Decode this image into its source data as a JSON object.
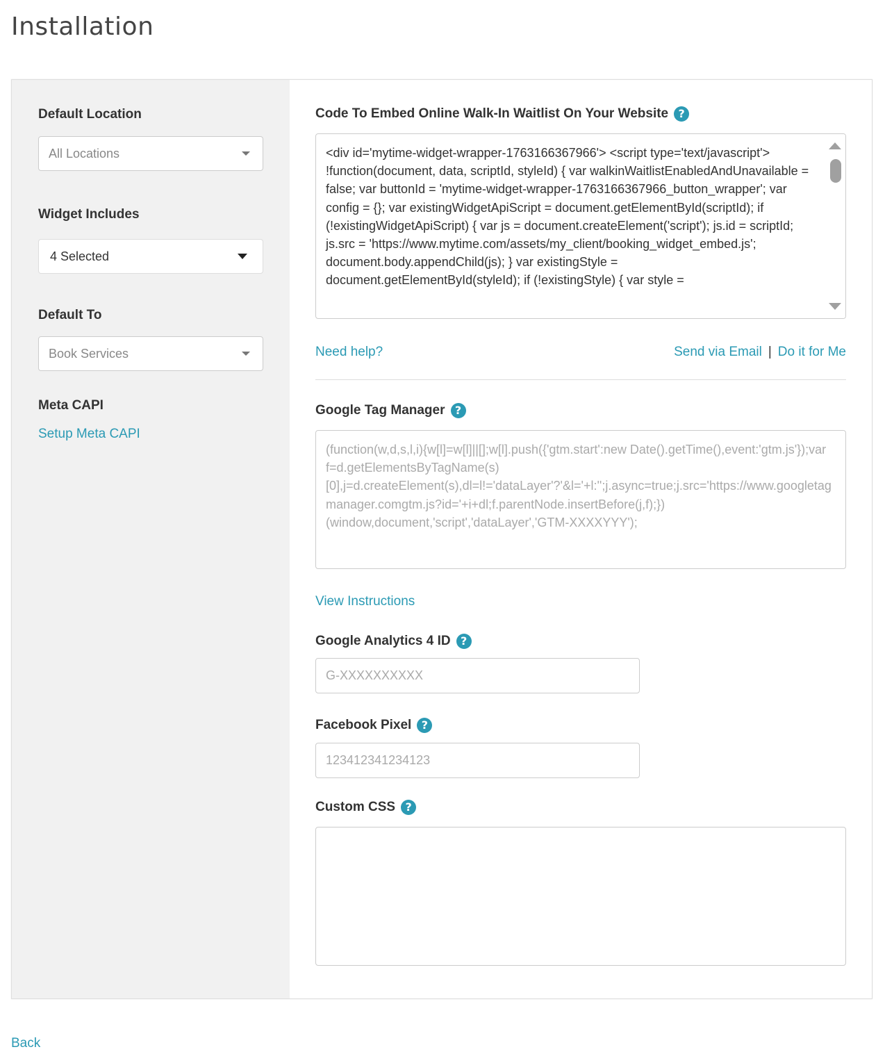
{
  "page": {
    "title": "Installation"
  },
  "sidebar": {
    "default_location": {
      "label": "Default Location",
      "value": "All Locations"
    },
    "widget_includes": {
      "label": "Widget Includes",
      "value": "4 Selected"
    },
    "default_to": {
      "label": "Default To",
      "value": "Book Services"
    },
    "meta_capi": {
      "label": "Meta CAPI",
      "link": "Setup Meta CAPI"
    }
  },
  "embed": {
    "label": "Code To Embed Online Walk-In Waitlist On Your Website",
    "help_icon": "?",
    "code": "<div id='mytime-widget-wrapper-1763166367966'> <script type='text/javascript'> !function(document, data, scriptId, styleId) { var walkinWaitlistEnabledAndUnavailable = false; var buttonId = 'mytime-widget-wrapper-1763166367966_button_wrapper';  var config = {}; var existingWidgetApiScript = document.getElementById(scriptId); if (!existingWidgetApiScript) { var js = document.createElement('script'); js.id = scriptId; js.src = 'https://www.mytime.com/assets/my_client/booking_widget_embed.js'; document.body.appendChild(js); } var existingStyle = document.getElementById(styleId); if (!existingStyle) { var style =",
    "need_help": "Need help?",
    "send_email": "Send via Email",
    "separator": "|",
    "do_it": "Do it for Me"
  },
  "gtm": {
    "label": "Google Tag Manager",
    "help_icon": "?",
    "placeholder": "(function(w,d,s,l,i){w[l]=w[l]||[];w[l].push({'gtm.start':new Date().getTime(),event:'gtm.js'});var f=d.getElementsByTagName(s)[0],j=d.createElement(s),dl=l!='dataLayer'?'&l='+l:'';j.async=true;j.src='https://www.googletagmanager.comgtm.js?id='+i+dl;f.parentNode.insertBefore(j,f);})(window,document,'script','dataLayer','GTM-XXXXYYY');",
    "view_instructions": "View Instructions"
  },
  "ga4": {
    "label": "Google Analytics 4 ID",
    "help_icon": "?",
    "placeholder": "G-XXXXXXXXXX",
    "value": ""
  },
  "fb_pixel": {
    "label": "Facebook Pixel",
    "help_icon": "?",
    "placeholder": "123412341234123",
    "value": ""
  },
  "custom_css": {
    "label": "Custom CSS",
    "help_icon": "?",
    "value": ""
  },
  "footer": {
    "back": "Back"
  },
  "colors": {
    "accent": "#2b9ab4",
    "sidebar_bg": "#f1f1f1"
  }
}
